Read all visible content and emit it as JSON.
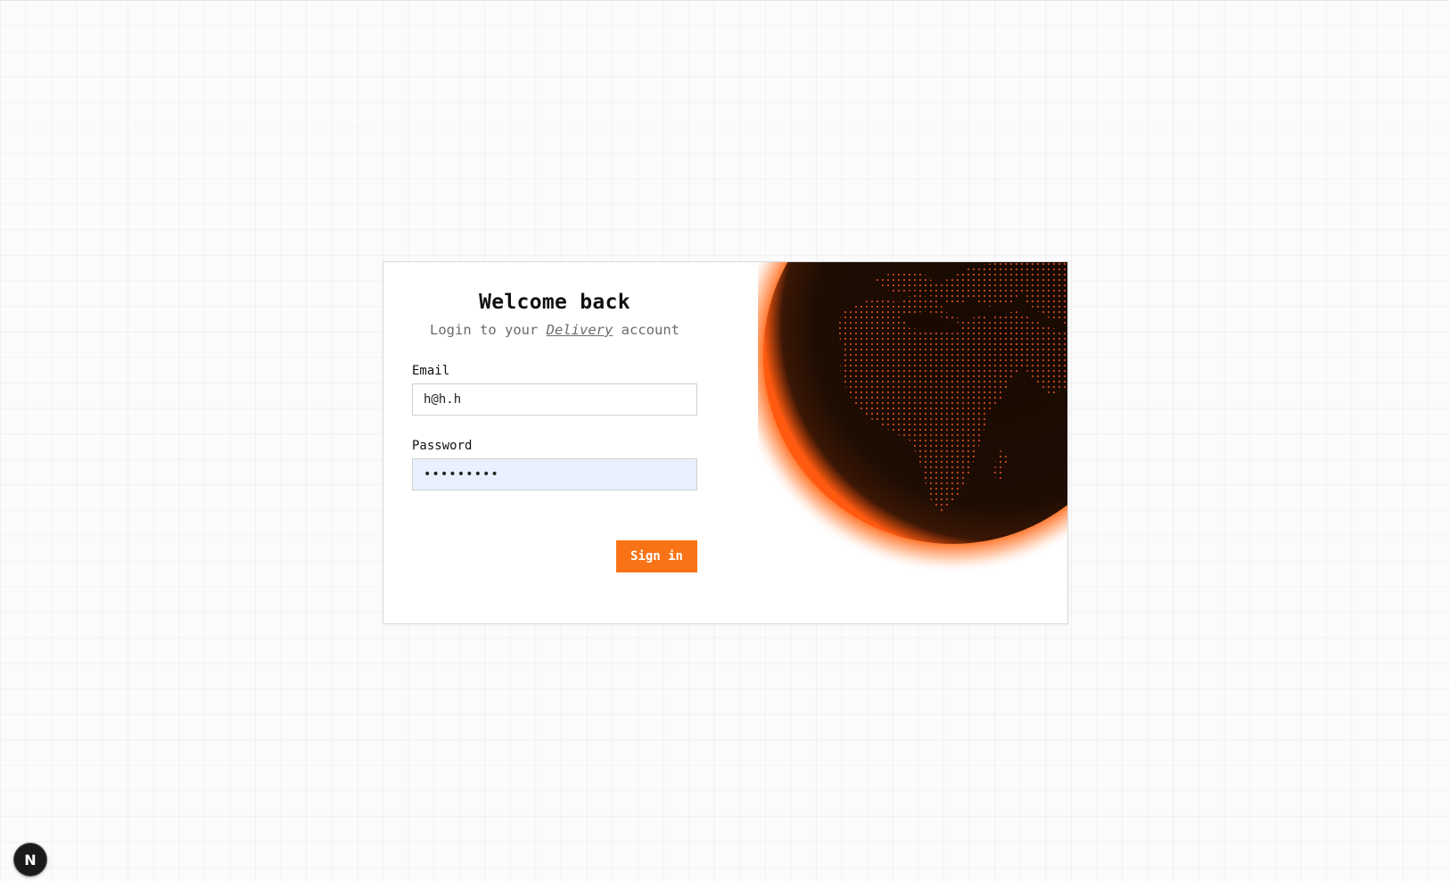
{
  "login": {
    "title": "Welcome back",
    "subtitle_prefix": "Login to your ",
    "subtitle_brand": "Delivery",
    "subtitle_suffix": " account",
    "email_label": "Email",
    "email_value": "h@h.h",
    "password_label": "Password",
    "password_value": "passw0rd1",
    "submit_label": "Sign in"
  },
  "globe": {
    "icon": "dotted-globe-illustration",
    "glow_color": "#ff6a1a",
    "body_color": "#1e0d03",
    "dot_color": "#e8552a"
  },
  "dev_badge": {
    "label": "N",
    "icon": "nextjs-logo-icon"
  }
}
